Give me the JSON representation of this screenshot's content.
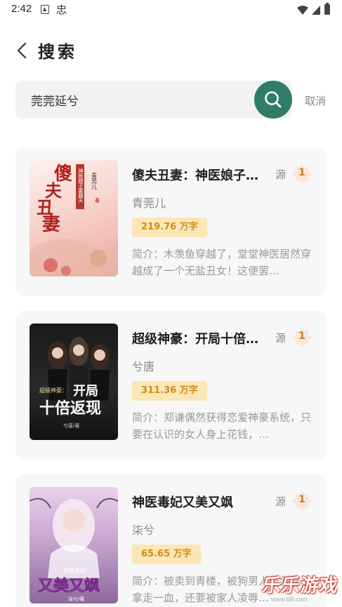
{
  "status_bar": {
    "time": "2:42",
    "icons": [
      "a-icon",
      "bug-icon",
      "wifi-icon",
      "signal-icon",
      "battery-icon"
    ]
  },
  "header": {
    "title": "搜索",
    "back_icon": "chevron-left-icon"
  },
  "search": {
    "value": "莞莞延兮",
    "button_icon": "search-icon",
    "cancel_label": "取消"
  },
  "colors": {
    "accent": "#2f7d69",
    "badge_bg": "#fbe7b5",
    "badge_text": "#d08a1a",
    "card_bg": "#f7f7f7",
    "search_bg": "#f2f2f2"
  },
  "results": [
    {
      "title": "傻夫丑妻：神医娘子…",
      "source_label": "源",
      "source_num": "1",
      "author": "青莞儿",
      "wordcount": "219.76 万字",
      "intro": "简介：木羡鱼穿越了，堂堂神医居然穿越成了一个无盐丑女！这便罢…",
      "cover": {
        "big_chars": [
          "傻",
          "夫",
          "丑",
          "妻"
        ],
        "subtitle": "神医娘子要翻天",
        "author": "青莞儿",
        "tag": "著"
      }
    },
    {
      "title": "超级神豪：开局十倍…",
      "source_label": "源",
      "source_num": "1",
      "author": "兮唐",
      "wordcount": "311.36 万字",
      "intro": "简介：郑谦偶然获得恋爱神豪系统，只要在认识的女人身上花钱，…",
      "cover": {
        "line1": "超级神豪：",
        "big1": "开局",
        "big2": "十倍返现",
        "author": "兮唐/著"
      }
    },
    {
      "title": "神医毒妃又美又飒",
      "source_label": "源",
      "source_num": "1",
      "author": "柒兮",
      "wordcount": "65.65 万字",
      "intro": "简介：被卖到青楼，被狗男人一剑穿心拿走一血，还要被家人凌辱…",
      "cover": {
        "top": "神医毒妃",
        "big": "又美又飒",
        "author": "柒兮/著"
      }
    }
  ],
  "watermark": {
    "text": "乐乐游戏",
    "url": "www.6lll.com"
  }
}
